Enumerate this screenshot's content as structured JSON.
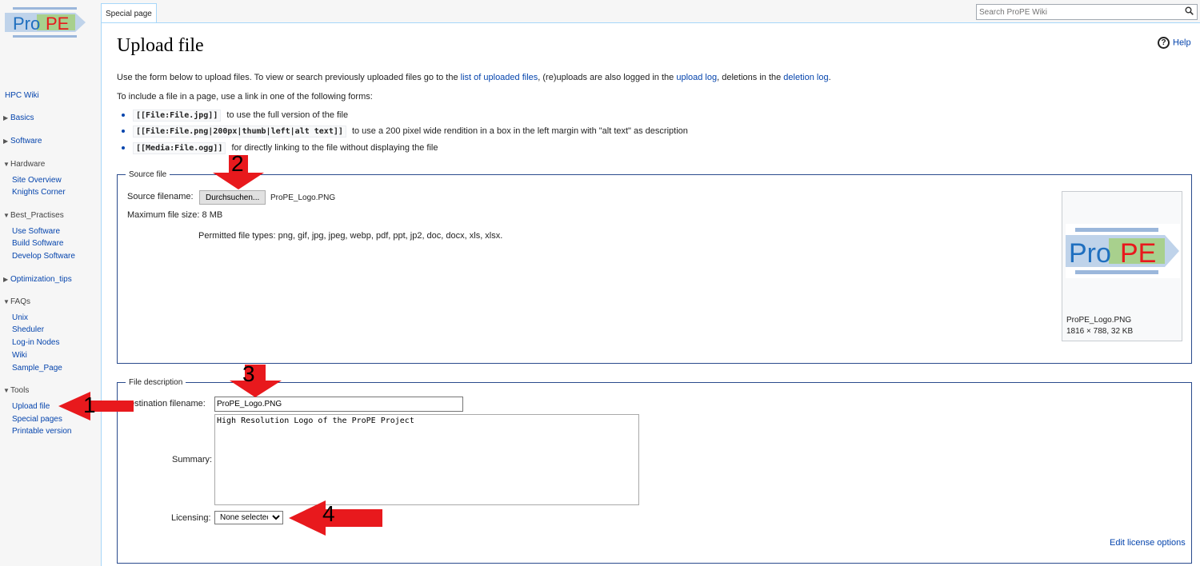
{
  "logo": {
    "text_pro": "Pro",
    "text_pe": "PE"
  },
  "sidebar": {
    "main_link": "HPC Wiki",
    "portlets": [
      {
        "label": "Basics",
        "expanded": false,
        "items": []
      },
      {
        "label": "Software",
        "expanded": false,
        "items": []
      },
      {
        "label": "Hardware",
        "expanded": true,
        "items": [
          "Site Overview",
          "Knights Corner"
        ]
      },
      {
        "label": "Best_Practises",
        "expanded": true,
        "items": [
          "Use Software",
          "Build Software",
          "Develop Software"
        ]
      },
      {
        "label": "Optimization_tips",
        "expanded": false,
        "items": []
      },
      {
        "label": "FAQs",
        "expanded": true,
        "items": [
          "Unix",
          "Sheduler",
          "Log-in Nodes",
          "Wiki",
          "Sample_Page"
        ]
      },
      {
        "label": "Tools",
        "expanded": true,
        "items": [
          "Upload file",
          "Special pages",
          "Printable version"
        ]
      }
    ]
  },
  "tabs": {
    "special": "Special page"
  },
  "search": {
    "placeholder": "Search ProPE Wiki",
    "icon": "search-icon"
  },
  "page": {
    "title": "Upload file",
    "help": "Help",
    "intro": {
      "pre": "Use the form below to upload files. To view or search previously uploaded files go to the ",
      "link1": "list of uploaded files",
      "mid1": ", (re)uploads are also logged in the ",
      "link2": "upload log",
      "mid2": ", deletions in the ",
      "link3": "deletion log",
      "post": "."
    },
    "include_text": "To include a file in a page, use a link in one of the following forms:",
    "forms": [
      {
        "code": "[[File:File.jpg]]",
        "desc": "to use the full version of the file"
      },
      {
        "code": "[[File:File.png|200px|thumb|left|alt text]]",
        "desc": "to use a 200 pixel wide rendition in a box in the left margin with \"alt text\" as description"
      },
      {
        "code": "[[Media:File.ogg]]",
        "desc": "for directly linking to the file without displaying the file"
      }
    ]
  },
  "source": {
    "legend": "Source file",
    "filename_label": "Source filename:",
    "browse_button": "Durchsuchen...",
    "chosen_file": "ProPE_Logo.PNG",
    "max_size": "Maximum file size: 8 MB",
    "permitted": "Permitted file types: png, gif, jpg, jpeg, webp, pdf, ppt, jp2, doc, docx, xls, xlsx.",
    "thumb_name": "ProPE_Logo.PNG",
    "thumb_dims": "1816 × 788, 32 KB"
  },
  "description": {
    "legend": "File description",
    "dest_label": "estination filename:",
    "dest_value": "ProPE_Logo.PNG",
    "summary_label": "Summary:",
    "summary_value": "High Resolution Logo of the ProPE Project",
    "licensing_label": "Licensing:",
    "licensing_value": "None selected",
    "edit_license": "Edit license options"
  },
  "annotations": {
    "n1": "1",
    "n2": "2",
    "n3": "3",
    "n4": "4",
    "color": "#e8191d"
  }
}
